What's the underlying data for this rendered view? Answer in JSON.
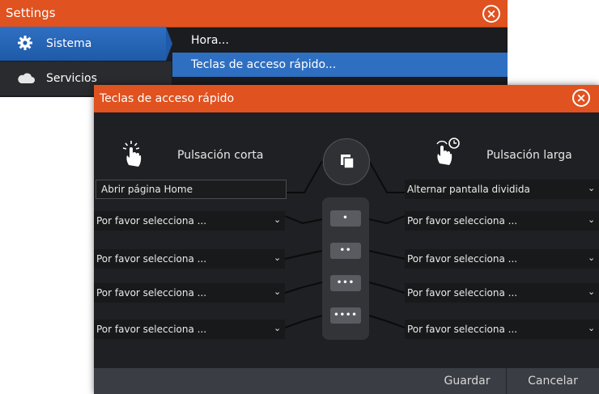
{
  "settings": {
    "title": "Settings",
    "close_icon": "×",
    "sidebar": [
      {
        "label": "Sistema",
        "icon": "gear-icon"
      },
      {
        "label": "Servicios",
        "icon": "cloud-icon"
      }
    ],
    "submenu": [
      "Hora...",
      "Teclas de acceso rápido..."
    ]
  },
  "dialog": {
    "title": "Teclas de acceso rápido",
    "close_icon": "×",
    "short_press_label": "Pulsación corta",
    "long_press_label": "Pulsación larga",
    "short_press": [
      "Abrir página Home",
      "Por favor selecciona ...",
      "Por favor selecciona ...",
      "Por favor selecciona ...",
      "Por favor selecciona ..."
    ],
    "long_press": [
      "Alternar pantalla dividida",
      "Por favor selecciona ...",
      "Por favor selecciona ...",
      "Por favor selecciona ...",
      "Por favor selecciona ..."
    ],
    "keys": [
      "•",
      "••",
      "•••",
      "••••"
    ],
    "save": "Guardar",
    "cancel": "Cancelar"
  },
  "colors": {
    "accent": "#e0521f",
    "selection": "#2f6fc2",
    "panel": "#1f2023"
  }
}
